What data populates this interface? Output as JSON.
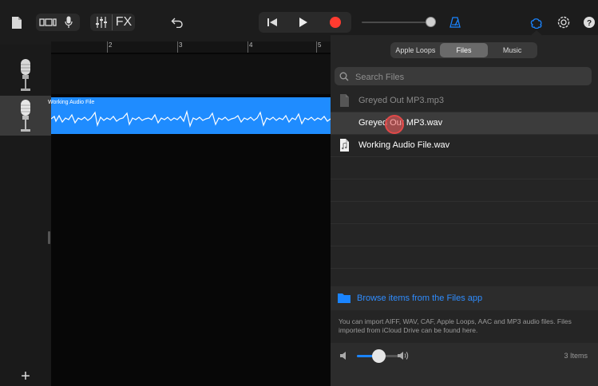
{
  "toolbar": {
    "fx_label": "FX",
    "accent_color": "#1a84ff",
    "record_color": "#ff3b30",
    "icons": [
      "document-icon",
      "view-toggle-icon",
      "mic-icon",
      "mixer-icon",
      "undo-icon",
      "skip-back-icon",
      "play-icon",
      "record-icon",
      "metronome-icon",
      "loop-browser-icon",
      "settings-icon",
      "help-icon"
    ]
  },
  "ruler": {
    "marks": [
      "2",
      "3",
      "4",
      "5"
    ]
  },
  "tracks": [
    {
      "icon": "microphone-icon",
      "selected": false
    },
    {
      "icon": "microphone-icon",
      "selected": true
    }
  ],
  "region": {
    "label": "Working Audio File",
    "color": "#1f8cff"
  },
  "browser": {
    "tabs": [
      {
        "label": "Apple Loops",
        "active": false
      },
      {
        "label": "Files",
        "active": true
      },
      {
        "label": "Music",
        "active": false
      }
    ],
    "search_placeholder": "Search Files",
    "files": [
      {
        "name": "Greyed Out MP3.mp3",
        "state": "disabled"
      },
      {
        "name": "Greyed Out MP3.wav",
        "state": "selected"
      },
      {
        "name": "Working Audio File.wav",
        "state": "enabled"
      }
    ],
    "browse_label": "Browse items from the Files app",
    "import_note": "You can import AIFF, WAV, CAF, Apple Loops, AAC and MP3 audio files. Files imported from iCloud Drive can be found here.",
    "preview_volume": 0.5,
    "item_count": "3 Items"
  },
  "add_track_label": "+"
}
